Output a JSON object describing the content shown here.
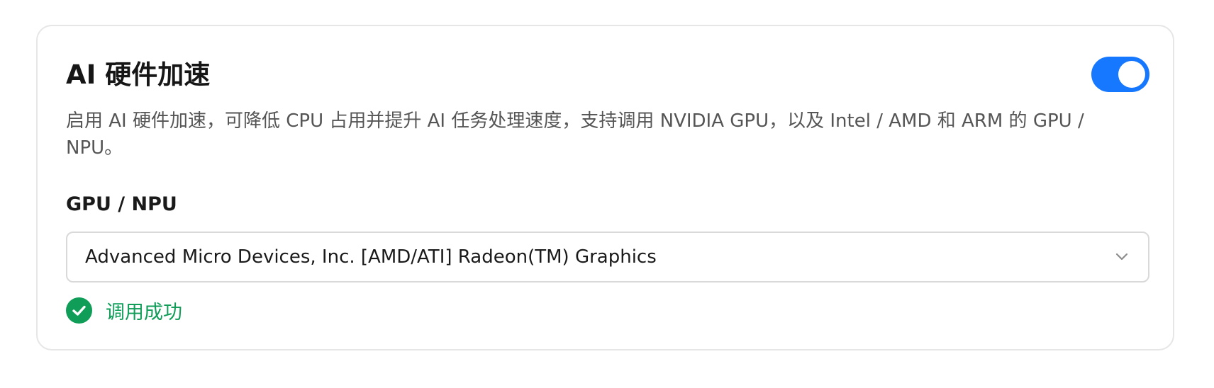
{
  "card": {
    "title": "AI 硬件加速",
    "toggle_on": true,
    "description": "启用 AI 硬件加速，可降低 CPU 占用并提升 AI 任务处理速度，支持调用 NVIDIA GPU，以及 Intel / AMD 和 ARM 的 GPU / NPU。"
  },
  "device": {
    "label": "GPU / NPU",
    "selected": "Advanced Micro Devices, Inc. [AMD/ATI] Radeon(TM) Graphics"
  },
  "status": {
    "text": "调用成功",
    "icon": "check-circle-icon",
    "color": "#0f9d58"
  },
  "colors": {
    "accent": "#1677ff",
    "success": "#0f9d58"
  }
}
